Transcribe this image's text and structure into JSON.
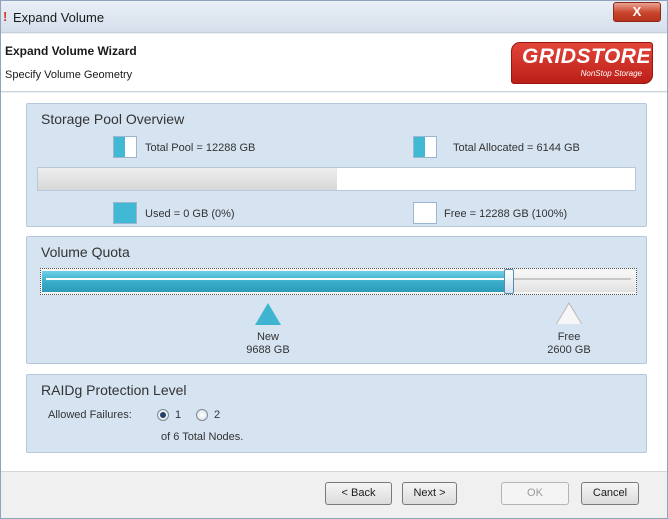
{
  "window": {
    "title": "Expand Volume",
    "app_icon": "!",
    "close_label": "X"
  },
  "header": {
    "title": "Expand Volume Wizard",
    "subtitle": "Specify Volume Geometry",
    "logo": {
      "name": "GRIDSTORE",
      "tagline": "NonStop Storage",
      "color": "#c8241c"
    }
  },
  "storage_pool": {
    "title": "Storage Pool Overview",
    "total_pool": "Total Pool = 12288 GB",
    "total_allocated": "Total Allocated = 6144 GB",
    "used": "Used = 0 GB (0%)",
    "free": "Free = 12288 GB (100%)",
    "allocated_fraction": 0.5
  },
  "volume_quota": {
    "title": "Volume Quota",
    "quota_fraction": 0.788,
    "new_label": "New",
    "new_value": "9688 GB",
    "free_label": "Free",
    "free_value": "2600 GB",
    "accent_color": "#3fb4d0"
  },
  "raid": {
    "title": "RAIDg Protection Level",
    "allowed_failures_label": "Allowed Failures:",
    "options": [
      "1",
      "2"
    ],
    "selected": "1",
    "nodes_text": "of 6 Total Nodes."
  },
  "footer": {
    "back_label": "< Back",
    "next_label": "Next >",
    "ok_label": "OK",
    "cancel_label": "Cancel"
  }
}
